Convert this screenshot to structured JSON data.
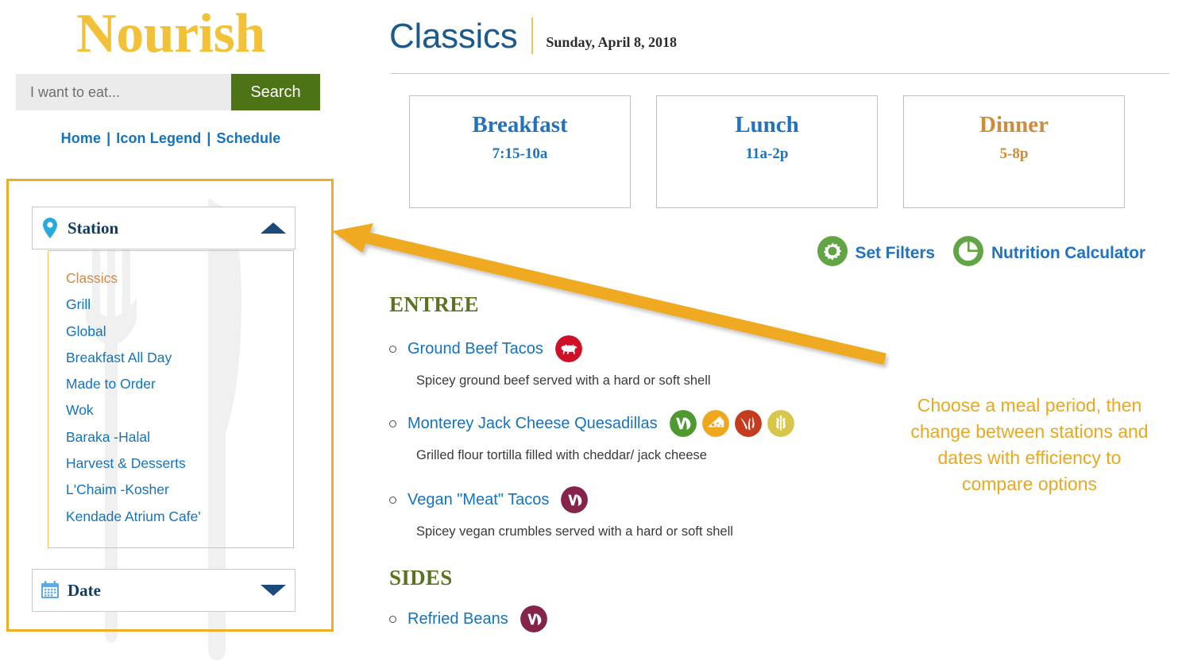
{
  "brand": {
    "title": "Nourish"
  },
  "search": {
    "placeholder": "I want to eat...",
    "value": "",
    "button_label": "Search"
  },
  "nav": {
    "items": [
      {
        "label": "Home"
      },
      {
        "label": "Icon Legend"
      },
      {
        "label": "Schedule"
      }
    ],
    "separator": "|"
  },
  "filters": {
    "station": {
      "label": "Station",
      "icon": "map-pin-icon",
      "expanded": true,
      "caret": "caret-up-icon",
      "options": [
        {
          "label": "Classics",
          "selected": true
        },
        {
          "label": "Grill",
          "selected": false
        },
        {
          "label": "Global",
          "selected": false
        },
        {
          "label": "Breakfast All Day",
          "selected": false
        },
        {
          "label": "Made to Order",
          "selected": false
        },
        {
          "label": "Wok",
          "selected": false
        },
        {
          "label": "Baraka -Halal",
          "selected": false
        },
        {
          "label": "Harvest & Desserts",
          "selected": false
        },
        {
          "label": "L'Chaim -Kosher",
          "selected": false
        },
        {
          "label": "Kendade Atrium Cafe'",
          "selected": false
        }
      ]
    },
    "date": {
      "label": "Date",
      "icon": "calendar-icon",
      "expanded": false,
      "caret": "caret-down-icon"
    }
  },
  "header": {
    "title": "Classics",
    "date": "Sunday, April 8, 2018"
  },
  "meal_periods": [
    {
      "name": "Breakfast",
      "time": "7:15-10a",
      "accent": "#2272C0"
    },
    {
      "name": "Lunch",
      "time": "11a-2p",
      "accent": "#2272C0"
    },
    {
      "name": "Dinner",
      "time": "5-8p",
      "accent": "#CE8B3A"
    }
  ],
  "tools": [
    {
      "label": "Set Filters",
      "icon": "gear-icon"
    },
    {
      "label": "Nutrition Calculator",
      "icon": "pie-chart-icon"
    }
  ],
  "sections": [
    {
      "heading": "ENTREE",
      "items": [
        {
          "name": "Ground Beef Tacos",
          "description": "Spicey ground beef served with a hard or soft shell",
          "icons": [
            {
              "name": "beef-icon",
              "color": "#CE1126"
            }
          ]
        },
        {
          "name": "Monterey Jack Cheese Quesadillas",
          "description": "Grilled flour tortilla filled with cheddar/ jack cheese",
          "icons": [
            {
              "name": "vegetarian-icon",
              "color": "#4F9A30"
            },
            {
              "name": "dairy-icon",
              "color": "#EFA71E"
            },
            {
              "name": "gluten-alert-icon",
              "color": "#C43B1E"
            },
            {
              "name": "wheat-icon",
              "color": "#D7C649"
            }
          ]
        },
        {
          "name": "Vegan \"Meat\" Tacos",
          "description": "Spicey vegan crumbles served with a hard or soft shell",
          "icons": [
            {
              "name": "vegan-icon",
              "color": "#85234A"
            }
          ]
        }
      ]
    },
    {
      "heading": "SIDES",
      "items": [
        {
          "name": "Refried Beans",
          "description": "",
          "icons": [
            {
              "name": "vegan-icon",
              "color": "#85234A"
            }
          ]
        }
      ]
    }
  ],
  "annotation": {
    "text": "Choose a meal period, then change between stations and dates with efficiency to compare options",
    "color": "#E9A81F",
    "arrow": "arrow-pointing-to-station-filter"
  },
  "colors": {
    "brand_yellow": "#F2C138",
    "link_blue": "#1573BE",
    "nav_blue": "#1573BE",
    "search_green": "#4d7317",
    "section_green": "#5A7321",
    "title_blue": "#1B5A8C",
    "highlight_orange": "#D9883C",
    "panel_border": "#EFAE27"
  }
}
